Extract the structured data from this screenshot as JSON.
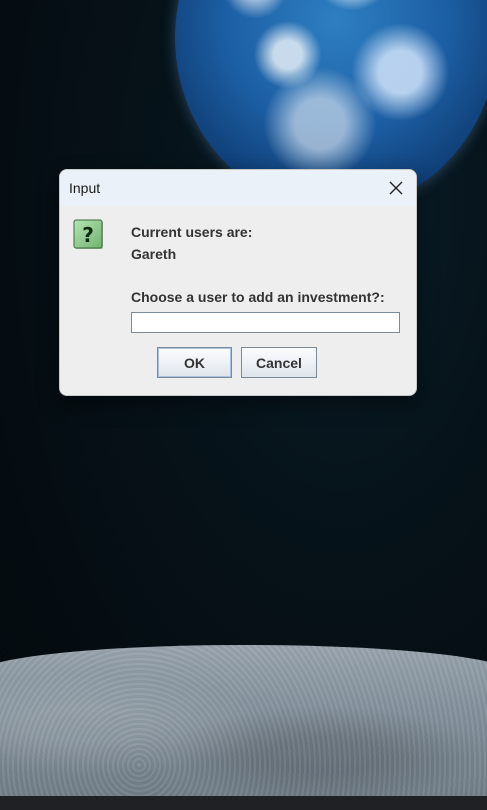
{
  "dialog": {
    "title": "Input",
    "message_lines": [
      "Current users are:",
      "Gareth"
    ],
    "prompt": "Choose a user to add an investment?:",
    "input_value": "",
    "ok_label": "OK",
    "cancel_label": "Cancel",
    "icon": "question-icon",
    "close_icon": "close-icon"
  },
  "colors": {
    "titlebar": "#eaf1f9",
    "dialog_bg": "#eeeeee",
    "icon_green": "#3f9a4a"
  }
}
